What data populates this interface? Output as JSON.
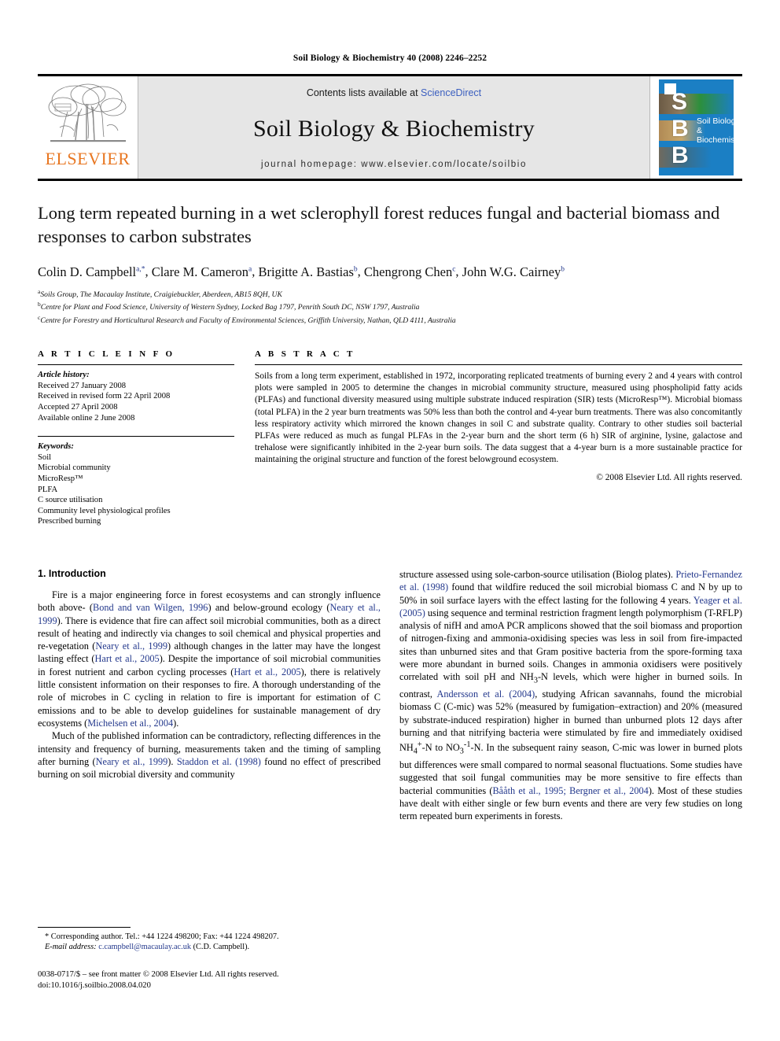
{
  "running_head": "Soil Biology & Biochemistry 40 (2008) 2246–2252",
  "masthead": {
    "publisher_name": "ELSEVIER",
    "publisher_logo_icon": "elsevier-tree-icon",
    "contents_prefix": "Contents lists available at ",
    "contents_link": "ScienceDirect",
    "journal_title": "Soil Biology & Biochemistry",
    "homepage": "journal homepage: www.elsevier.com/locate/soilbio",
    "cover": {
      "letters": "S\nB\nB",
      "letter_1": "S",
      "letter_2": "B",
      "letter_3": "B",
      "title_line_1": "Soil Biology &",
      "title_line_2": "Biochemistry"
    }
  },
  "article": {
    "title": "Long term repeated burning in a wet sclerophyll forest reduces fungal and bacterial biomass and responses to carbon substrates",
    "authors": [
      {
        "name": "Colin D. Campbell",
        "marks": "a,*"
      },
      {
        "name": "Clare M. Cameron",
        "marks": "a"
      },
      {
        "name": "Brigitte A. Bastias",
        "marks": "b"
      },
      {
        "name": "Chengrong Chen",
        "marks": "c"
      },
      {
        "name": "John W.G. Cairney",
        "marks": "b"
      }
    ],
    "affiliations": [
      {
        "mark": "a",
        "text": "Soils Group, The Macaulay Institute, Craigiebuckler, Aberdeen, AB15 8QH, UK"
      },
      {
        "mark": "b",
        "text": "Centre for Plant and Food Science, University of Western Sydney, Locked Bag 1797, Penrith South DC, NSW 1797, Australia"
      },
      {
        "mark": "c",
        "text": "Centre for Forestry and Horticultural Research and Faculty of Environmental Sciences, Griffith University, Nathan, QLD 4111, Australia"
      }
    ]
  },
  "article_info": {
    "heading": "A R T I C L E  I N F O",
    "history_label": "Article history:",
    "history": [
      "Received 27 January 2008",
      "Received in revised form 22 April 2008",
      "Accepted 27 April 2008",
      "Available online 2 June 2008"
    ],
    "keywords_label": "Keywords:",
    "keywords": [
      "Soil",
      "Microbial community",
      "MicroResp™",
      "PLFA",
      "C source utilisation",
      "Community level physiological profiles",
      "Prescribed burning"
    ]
  },
  "abstract": {
    "heading": "A B S T R A C T",
    "text": "Soils from a long term experiment, established in 1972, incorporating replicated treatments of burning every 2 and 4 years with control plots were sampled in 2005 to determine the changes in microbial community structure, measured using phospholipid fatty acids (PLFAs) and functional diversity measured using multiple substrate induced respiration (SIR) tests (MicroResp™). Microbial biomass (total PLFA) in the 2 year burn treatments was 50% less than both the control and 4-year burn treatments. There was also concomitantly less respiratory activity which mirrored the known changes in soil C and substrate quality. Contrary to other studies soil bacterial PLFAs were reduced as much as fungal PLFAs in the 2-year burn and the short term (6 h) SIR of arginine, lysine, galactose and trehalose were significantly inhibited in the 2-year burn soils. The data suggest that a 4-year burn is a more sustainable practice for maintaining the original structure and function of the forest belowground ecosystem.",
    "copyright": "© 2008 Elsevier Ltd. All rights reserved."
  },
  "introduction": {
    "heading": "1. Introduction",
    "left_paragraphs": [
      "Fire is a major engineering force in forest ecosystems and can strongly influence both above- (Bond and van Wilgen, 1996) and below-ground ecology (Neary et al., 1999). There is evidence that fire can affect soil microbial communities, both as a direct result of heating and indirectly via changes to soil chemical and physical properties and re-vegetation (Neary et al., 1999) although changes in the latter may have the longest lasting effect (Hart et al., 2005). Despite the importance of soil microbial communities in forest nutrient and carbon cycling processes (Hart et al., 2005), there is relatively little consistent information on their responses to fire. A thorough understanding of the role of microbes in C cycling in relation to fire is important for estimation of C emissions and to be able to develop guidelines for sustainable management of dry ecosystems (Michelsen et al., 2004).",
      "Much of the published information can be contradictory, reflecting differences in the intensity and frequency of burning, measurements taken and the timing of sampling after burning (Neary et al., 1999). Staddon et al. (1998) found no effect of prescribed burning on soil microbial diversity and community"
    ],
    "right_paragraphs": [
      "structure assessed using sole-carbon-source utilisation (Biolog plates). Prieto-Fernandez et al. (1998) found that wildfire reduced the soil microbial biomass C and N by up to 50% in soil surface layers with the effect lasting for the following 4 years. Yeager et al. (2005) using sequence and terminal restriction fragment length polymorphism (T-RFLP) analysis of nifH and amoA PCR amplicons showed that the soil biomass and proportion of nitrogen-fixing and ammonia-oxidising species was less in soil from fire-impacted sites than unburned sites and that Gram positive bacteria from the spore-forming taxa were more abundant in burned soils. Changes in ammonia oxidisers were positively correlated with soil pH and NH3-N levels, which were higher in burned soils. In contrast, Andersson et al. (2004), studying African savannahs, found the microbial biomass C (C-mic) was 52% (measured by fumigation–extraction) and 20% (measured by substrate-induced respiration) higher in burned than unburned plots 12 days after burning and that nitrifying bacteria were stimulated by fire and immediately oxidised NH4+-N to NO3-1-N. In the subsequent rainy season, C-mic was lower in burned plots but differences were small compared to normal seasonal fluctuations. Some studies have suggested that soil fungal communities may be more sensitive to fire effects than bacterial communities (Bååth et al., 1995; Bergner et al., 2004). Most of these studies have dealt with either single or few burn events and there are very few studies on long term repeated burn experiments in forests."
    ]
  },
  "footnote": {
    "corresponding": "* Corresponding author. Tel.: +44 1224 498200; Fax: +44 1224 498207.",
    "email_label": "E-mail address:",
    "email": "c.campbell@macaulay.ac.uk",
    "email_owner": "(C.D. Campbell)."
  },
  "footer": {
    "issn_line": "0038-0717/$ – see front matter © 2008 Elsevier Ltd. All rights reserved.",
    "doi_line": "doi:10.1016/j.soilbio.2008.04.020"
  }
}
